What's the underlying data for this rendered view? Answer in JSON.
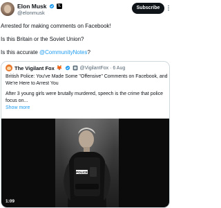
{
  "author": {
    "name": "Elon Musk",
    "handle": "@elonmusk",
    "avatar": "profile-photo",
    "verified_icon": "verified-badge-icon",
    "affiliation_icon": "x-logo-icon"
  },
  "actions": {
    "subscribe_label": "Subscribe",
    "more_icon": "more-options-icon"
  },
  "tweet": {
    "line1": "Arrested for making comments on Facebook!",
    "line2": "Is this Britain or the Soviet Union?",
    "line3_prefix": "Is this accurate ",
    "line3_mention": "@CommunityNotes",
    "line3_suffix": "?"
  },
  "quote": {
    "name": "The Vigilant Fox",
    "emoji": "🦊",
    "handle_date": "@VigilantFox · 6 Aug",
    "title_line1": "British Police: You've Made Some \"Offensive\" Comments on Facebook, and",
    "title_line2": "We're Here to Arrest You",
    "body_line1": "After 3 young girls were brutally murdered, speech is the crime that police",
    "body_line2": "focus on...",
    "show_more": "Show more"
  },
  "video": {
    "duration": "1:09"
  },
  "colors": {
    "accent": "#1d9bf0",
    "verified": "#1d9bf0",
    "text": "#0f1419",
    "muted": "#536471",
    "border": "#cfd9de"
  }
}
